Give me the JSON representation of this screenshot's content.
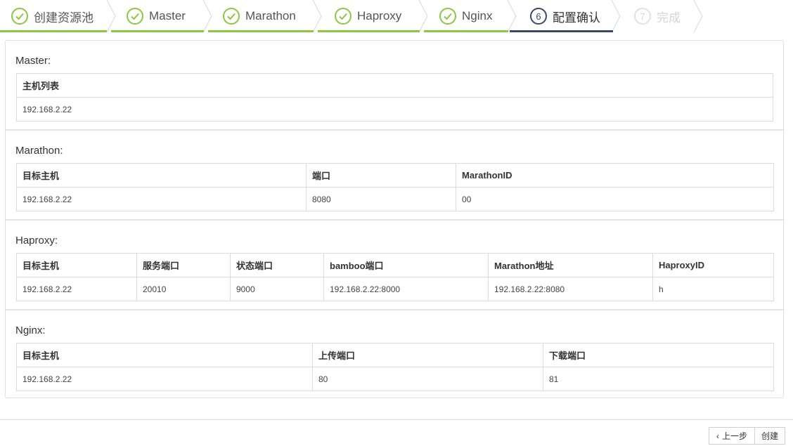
{
  "wizard": {
    "steps": [
      {
        "label": "创建资源池",
        "state": "done"
      },
      {
        "label": "Master",
        "state": "done"
      },
      {
        "label": "Marathon",
        "state": "done"
      },
      {
        "label": "Haproxy",
        "state": "done"
      },
      {
        "label": "Nginx",
        "state": "done"
      },
      {
        "label": "配置确认",
        "state": "active",
        "number": "6"
      },
      {
        "label": "完成",
        "state": "todo",
        "number": "7"
      }
    ],
    "colors": {
      "done": "#8dc63f",
      "active": "#3a4a66",
      "todo": "#d5d5d5"
    }
  },
  "sections": {
    "master": {
      "title": "Master:",
      "headers": [
        "主机列表"
      ],
      "rows": [
        [
          "192.168.2.22"
        ]
      ]
    },
    "marathon": {
      "title": "Marathon:",
      "headers": [
        "目标主机",
        "端口",
        "MarathonID"
      ],
      "rows": [
        [
          "192.168.2.22",
          "8080",
          "00"
        ]
      ]
    },
    "haproxy": {
      "title": "Haproxy:",
      "headers": [
        "目标主机",
        "服务端口",
        "状态端口",
        "bamboo端口",
        "Marathon地址",
        "HaproxyID"
      ],
      "rows": [
        [
          "192.168.2.22",
          "20010",
          "9000",
          "192.168.2.22:8000",
          "192.168.2.22:8080",
          "h"
        ]
      ]
    },
    "nginx": {
      "title": "Nginx:",
      "headers": [
        "目标主机",
        "上传端口",
        "下载端口"
      ],
      "rows": [
        [
          "192.168.2.22",
          "80",
          "81"
        ]
      ]
    }
  },
  "footer": {
    "prev_label": "上一步",
    "create_label": "创建"
  }
}
